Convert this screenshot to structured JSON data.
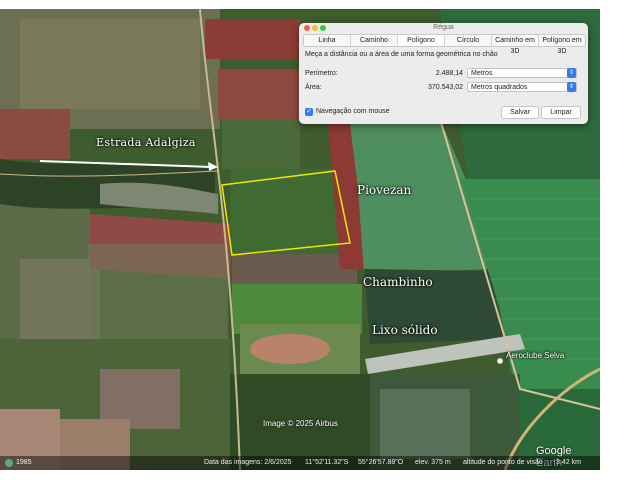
{
  "ruler": {
    "title": "Régua",
    "tabs": [
      {
        "label": "Linha"
      },
      {
        "label": "Caminho"
      },
      {
        "label": "Polígono"
      },
      {
        "label": "Círculo"
      },
      {
        "label": "Caminho em 3D"
      },
      {
        "label": "Polígono em 3D"
      }
    ],
    "active_tab": "Polígono",
    "description": "Meça a distância ou a área de uma forma geométrica no chão",
    "perimeter_label": "Perímetro:",
    "perimeter_value": "2.488,14",
    "perimeter_unit": "Metros",
    "area_label": "Área:",
    "area_value": "370.543,02",
    "area_unit": "Metros quadrados",
    "navigation_label": "Navegação com mouse",
    "navigation_checked": true,
    "save_label": "Salvar",
    "clear_label": "Limpar"
  },
  "map": {
    "labels": {
      "estrada": "Estrada Adalgiza",
      "piovezan": "Piovezan",
      "chambinho": "Chambinho",
      "lixo": "Lixo sólido",
      "aeroclube": "Aeroclube Selva"
    },
    "copyright": "Image © 2025 Airbus",
    "logo": "Google Earth",
    "polygon_color": "#f2e600"
  },
  "status": {
    "year": "1985",
    "imagery_date": "Data das imagens: 2/6/2025",
    "latitude": "11°52'11.32\"S",
    "longitude": "55°26'57.88\"O",
    "elevation": "elev. 375 m",
    "eye_altitude_label": "altitude do ponto de visão",
    "eye_altitude_value": "3.42 km"
  }
}
